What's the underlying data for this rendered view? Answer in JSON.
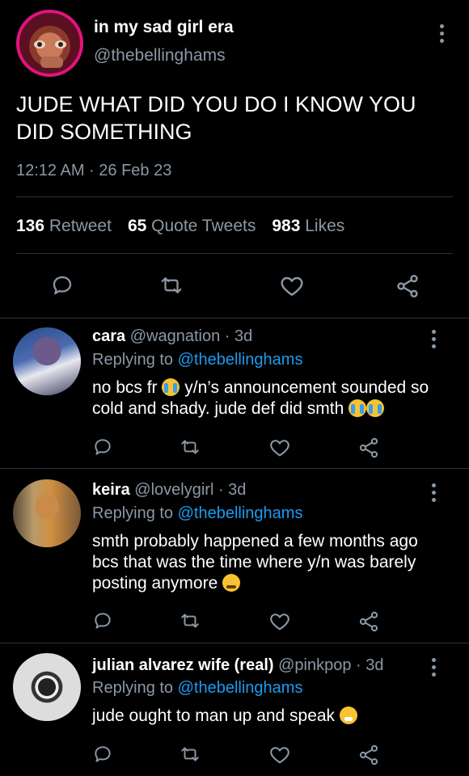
{
  "main_tweet": {
    "display_name": "in my sad girl era",
    "handle": "@thebellinghams",
    "text_line1": "JUDE WHAT DID YOU DO I KNOW YOU",
    "text_line2": "DID SOMETHING",
    "timestamp": "12:12 AM · 26 Feb 23",
    "stats": {
      "retweets_count": "136",
      "retweets_label": "Retweet",
      "quotes_count": "65",
      "quotes_label": "Quote Tweets",
      "likes_count": "983",
      "likes_label": "Likes"
    }
  },
  "replies": [
    {
      "name": "cara",
      "handle": "@wagnation · 3d",
      "replying_prefix": "Replying to",
      "replying_to": "@thebellinghams",
      "text_a": "no bcs fr",
      "text_b": "y/n’s announcement sounded so cold and shady. jude def did smth"
    },
    {
      "name": "keira",
      "handle": "@lovelygirl · 3d",
      "replying_prefix": "Replying to",
      "replying_to": "@thebellinghams",
      "text_a": "smth probably happened a few months ago bcs that was the time where y/n was barely posting anymore"
    },
    {
      "name": "julian alvarez wife (real)",
      "handle": "@pinkpop · 3d",
      "replying_prefix": "Replying to",
      "replying_to": "@thebellinghams",
      "text_a": "jude ought to man up and speak"
    }
  ],
  "icons": {
    "reply": "reply-icon",
    "retweet": "retweet-icon",
    "like": "heart-icon",
    "share": "share-icon",
    "more": "more-options-icon"
  },
  "colors": {
    "background": "#000000",
    "text": "#e7e9ea",
    "muted": "#8b98a5",
    "link": "#1d9bf0",
    "divider": "#2f3336",
    "avatar_ring": "#e2137e"
  }
}
